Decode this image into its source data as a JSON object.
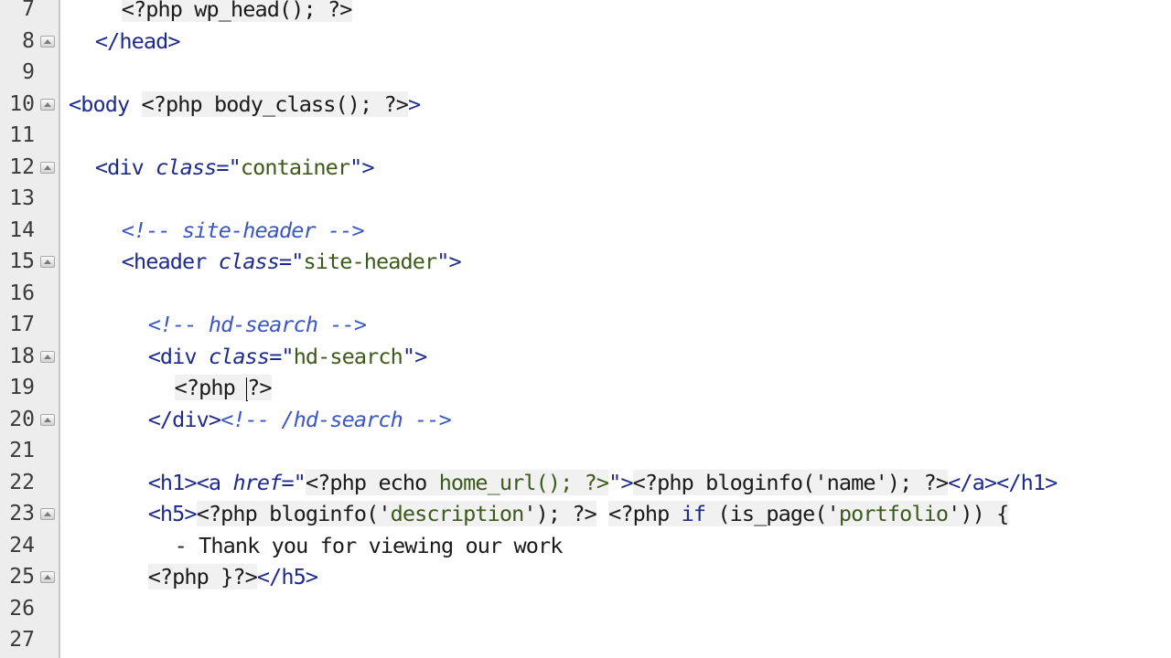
{
  "editor": {
    "first_line_number": 7,
    "lines": [
      {
        "num": "7",
        "fold": false,
        "indent": 4,
        "tokens": [
          {
            "t": "<?php wp_head(); ?>",
            "c": "php",
            "bg": true
          }
        ]
      },
      {
        "num": "8",
        "fold": true,
        "indent": 2,
        "tokens": [
          {
            "t": "</head>",
            "c": "tag"
          }
        ]
      },
      {
        "num": "9",
        "fold": false,
        "indent": 0,
        "tokens": []
      },
      {
        "num": "10",
        "fold": true,
        "indent": 0,
        "tokens": [
          {
            "t": "<body ",
            "c": "tag"
          },
          {
            "t": "<?php body_class(); ?>",
            "c": "php",
            "bg": true
          },
          {
            "t": ">",
            "c": "tag"
          }
        ]
      },
      {
        "num": "11",
        "fold": false,
        "indent": 0,
        "tokens": []
      },
      {
        "num": "12",
        "fold": true,
        "indent": 2,
        "tokens": [
          {
            "t": "<div ",
            "c": "tag"
          },
          {
            "t": "class",
            "c": "attr"
          },
          {
            "t": "=\"",
            "c": "tag"
          },
          {
            "t": "container",
            "c": "str"
          },
          {
            "t": "\">",
            "c": "tag"
          }
        ]
      },
      {
        "num": "13",
        "fold": false,
        "indent": 0,
        "tokens": []
      },
      {
        "num": "14",
        "fold": false,
        "indent": 4,
        "tokens": [
          {
            "t": "<!-- site-header -->",
            "c": "comment"
          }
        ]
      },
      {
        "num": "15",
        "fold": true,
        "indent": 4,
        "tokens": [
          {
            "t": "<header ",
            "c": "tag"
          },
          {
            "t": "class",
            "c": "attr"
          },
          {
            "t": "=\"",
            "c": "tag"
          },
          {
            "t": "site-header",
            "c": "str"
          },
          {
            "t": "\">",
            "c": "tag"
          }
        ]
      },
      {
        "num": "16",
        "fold": false,
        "indent": 0,
        "tokens": []
      },
      {
        "num": "17",
        "fold": false,
        "indent": 6,
        "tokens": [
          {
            "t": "<!-- hd-search -->",
            "c": "comment"
          }
        ]
      },
      {
        "num": "18",
        "fold": true,
        "indent": 6,
        "tokens": [
          {
            "t": "<div ",
            "c": "tag"
          },
          {
            "t": "class",
            "c": "attr"
          },
          {
            "t": "=\"",
            "c": "tag"
          },
          {
            "t": "hd-search",
            "c": "str"
          },
          {
            "t": "\">",
            "c": "tag"
          }
        ]
      },
      {
        "num": "19",
        "fold": false,
        "indent": 8,
        "caret_after": "<?php ",
        "tokens": [
          {
            "t": "<?php ",
            "c": "php",
            "bg": true
          },
          {
            "t": "?>",
            "c": "php",
            "bg": true
          }
        ]
      },
      {
        "num": "20",
        "fold": true,
        "indent": 6,
        "tokens": [
          {
            "t": "</div>",
            "c": "tag"
          },
          {
            "t": "<!-- /hd-search -->",
            "c": "comment"
          }
        ]
      },
      {
        "num": "21",
        "fold": false,
        "indent": 0,
        "tokens": []
      },
      {
        "num": "22",
        "fold": false,
        "indent": 6,
        "tokens": [
          {
            "t": "<h1>",
            "c": "tag"
          },
          {
            "t": "<a ",
            "c": "tag"
          },
          {
            "t": "href",
            "c": "attr"
          },
          {
            "t": "=\"",
            "c": "tag"
          },
          {
            "t": "<?php ",
            "c": "php",
            "bg": true
          },
          {
            "t": "echo ",
            "c": "php",
            "bg": true
          },
          {
            "t": "home_url(); ?>",
            "c": "str",
            "bg": true
          },
          {
            "t": "\">",
            "c": "tag"
          },
          {
            "t": "<?php bloginfo('name'); ?>",
            "c": "php",
            "bg": true
          },
          {
            "t": "</a>",
            "c": "tag"
          },
          {
            "t": "</h1>",
            "c": "tag"
          }
        ]
      },
      {
        "num": "23",
        "fold": true,
        "indent": 6,
        "tokens": [
          {
            "t": "<h5>",
            "c": "tag"
          },
          {
            "t": "<?php bloginfo('",
            "c": "php",
            "bg": true
          },
          {
            "t": "description",
            "c": "str",
            "bg": true
          },
          {
            "t": "'); ?>",
            "c": "php",
            "bg": true
          },
          {
            "t": " ",
            "c": "plain"
          },
          {
            "t": "<?php ",
            "c": "php",
            "bg": true
          },
          {
            "t": "if",
            "c": "kw",
            "bg": true
          },
          {
            "t": " (is_page('",
            "c": "php",
            "bg": true
          },
          {
            "t": "portfolio",
            "c": "str",
            "bg": true
          },
          {
            "t": "')) {",
            "c": "php",
            "bg": true
          }
        ]
      },
      {
        "num": "24",
        "fold": false,
        "indent": 8,
        "tokens": [
          {
            "t": "- Thank you for viewing our work",
            "c": "plain"
          }
        ]
      },
      {
        "num": "25",
        "fold": true,
        "indent": 6,
        "tokens": [
          {
            "t": "<?php }?>",
            "c": "php",
            "bg": true
          },
          {
            "t": "</h5>",
            "c": "tag"
          }
        ]
      },
      {
        "num": "26",
        "fold": false,
        "indent": 0,
        "tokens": []
      },
      {
        "num": "27",
        "fold": false,
        "indent": 0,
        "tokens": []
      }
    ]
  },
  "icons": {
    "fold": "fold-triangle-icon"
  },
  "colors": {
    "gutter_bg": "#ededed",
    "tag": "#1e2a8c",
    "string": "#3c5a1a",
    "comment": "#3c57c4",
    "php_bg": "#f1f1f1"
  }
}
